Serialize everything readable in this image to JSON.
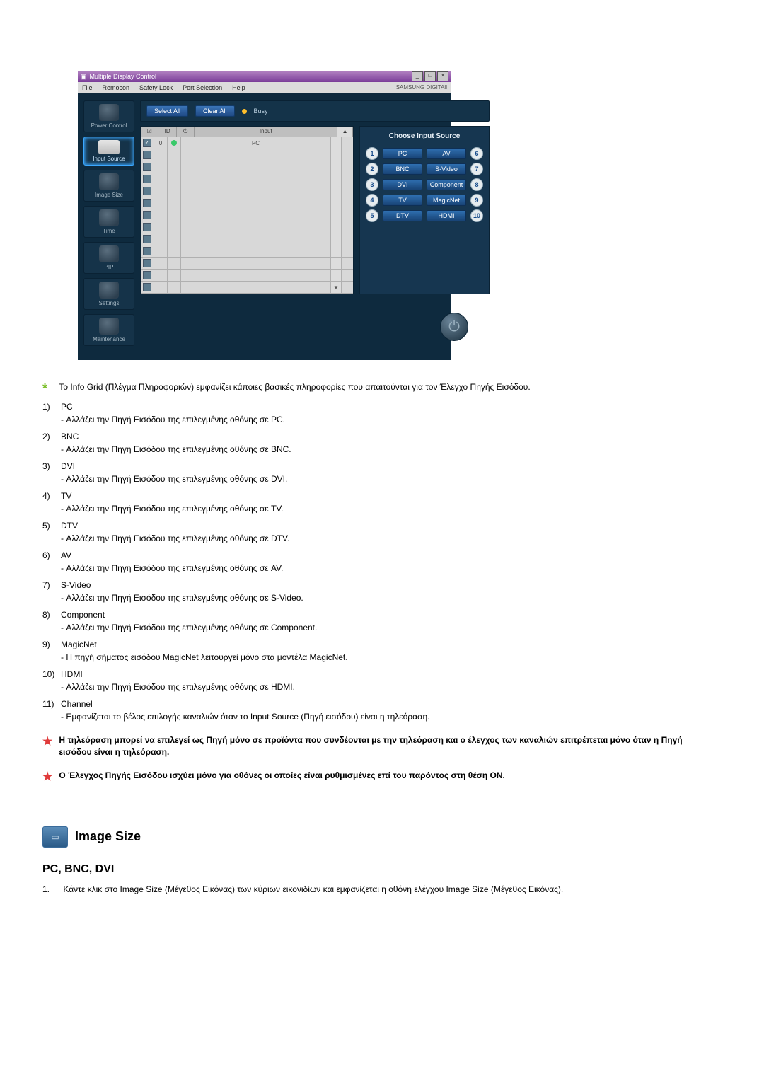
{
  "app": {
    "title": "Multiple Display Control",
    "menus": [
      "File",
      "Remocon",
      "Safety Lock",
      "Port Selection",
      "Help"
    ],
    "brand": "SAMSUNG DIGITAll"
  },
  "sidebar": {
    "items": [
      {
        "label": "Power Control"
      },
      {
        "label": "Input Source"
      },
      {
        "label": "Image Size"
      },
      {
        "label": "Time"
      },
      {
        "label": "PIP"
      },
      {
        "label": "Settings"
      },
      {
        "label": "Maintenance"
      }
    ]
  },
  "topbar": {
    "select_all": "Select All",
    "clear_all": "Clear All",
    "busy": "Busy"
  },
  "grid": {
    "cols": {
      "id": "ID",
      "input": "Input",
      "pc": "PC"
    },
    "first_row": {
      "id": "0",
      "pc": "PC"
    },
    "power_icon": "⏻"
  },
  "panel": {
    "title": "Choose Input Source",
    "sources_left": [
      {
        "n": "1",
        "label": "PC"
      },
      {
        "n": "2",
        "label": "BNC"
      },
      {
        "n": "3",
        "label": "DVI"
      },
      {
        "n": "4",
        "label": "TV"
      },
      {
        "n": "5",
        "label": "DTV"
      }
    ],
    "sources_right": [
      {
        "n": "6",
        "label": "AV"
      },
      {
        "n": "7",
        "label": "S-Video"
      },
      {
        "n": "8",
        "label": "Component"
      },
      {
        "n": "9",
        "label": "MagicNet"
      },
      {
        "n": "10",
        "label": "HDMI"
      }
    ]
  },
  "doc": {
    "info_star": "Το Info Grid (Πλέγμα Πληροφοριών) εμφανίζει κάποιες βασικές πληροφορίες που απαιτούνται για τον Έλεγχο Πηγής Εισόδου.",
    "items": [
      {
        "n": "1)",
        "t": "PC",
        "d": "- Αλλάζει την Πηγή Εισόδου της επιλεγμένης οθόνης σε PC."
      },
      {
        "n": "2)",
        "t": "BNC",
        "d": "- Αλλάζει την Πηγή Εισόδου της επιλεγμένης οθόνης σε BNC."
      },
      {
        "n": "3)",
        "t": "DVI",
        "d": "- Αλλάζει την Πηγή Εισόδου της επιλεγμένης οθόνης σε DVI."
      },
      {
        "n": "4)",
        "t": "TV",
        "d": "- Αλλάζει την Πηγή Εισόδου της επιλεγμένης οθόνης σε TV."
      },
      {
        "n": "5)",
        "t": "DTV",
        "d": "- Αλλάζει την Πηγή Εισόδου της επιλεγμένης οθόνης σε DTV."
      },
      {
        "n": "6)",
        "t": "AV",
        "d": "- Αλλάζει την Πηγή Εισόδου της επιλεγμένης οθόνης σε AV."
      },
      {
        "n": "7)",
        "t": "S-Video",
        "d": "- Αλλάζει την Πηγή Εισόδου της επιλεγμένης οθόνης σε S-Video."
      },
      {
        "n": "8)",
        "t": "Component",
        "d": "- Αλλάζει την Πηγή Εισόδου της επιλεγμένης οθόνης σε Component."
      },
      {
        "n": "9)",
        "t": "MagicNet",
        "d": "- Η πηγή σήματος εισόδου MagicNet λειτουργεί μόνο στα μοντέλα MagicNet."
      },
      {
        "n": "10)",
        "t": "HDMI",
        "d": "- Αλλάζει την Πηγή Εισόδου της επιλεγμένης οθόνης σε HDMI."
      },
      {
        "n": "11)",
        "t": "Channel",
        "d": "- Εμφανίζεται το βέλος επιλογής καναλιών όταν το Input Source (Πηγή εισόδου) είναι η τηλεόραση."
      }
    ],
    "note1": "Η τηλεόραση μπορεί να επιλεγεί ως Πηγή μόνο σε προϊόντα που συνδέονται με την τηλεόραση και ο έλεγχος των καναλιών επιτρέπεται μόνο όταν η Πηγή εισόδου είναι η τηλεόραση.",
    "note2": "Ο Έλεγχος Πηγής Εισόδου ισχύει μόνο για οθόνες οι οποίες είναι ρυθμισμένες επί του παρόντος στη θέση ON.",
    "section_title": "Image Size",
    "sub_title": "PC, BNC, DVI",
    "sub_item_n": "1.",
    "sub_item": "Κάντε κλικ στο Image Size (Μέγεθος Εικόνας) των κύριων εικονιδίων και εμφανίζεται η οθόνη ελέγχου Image Size (Μέγεθος Εικόνας)."
  }
}
